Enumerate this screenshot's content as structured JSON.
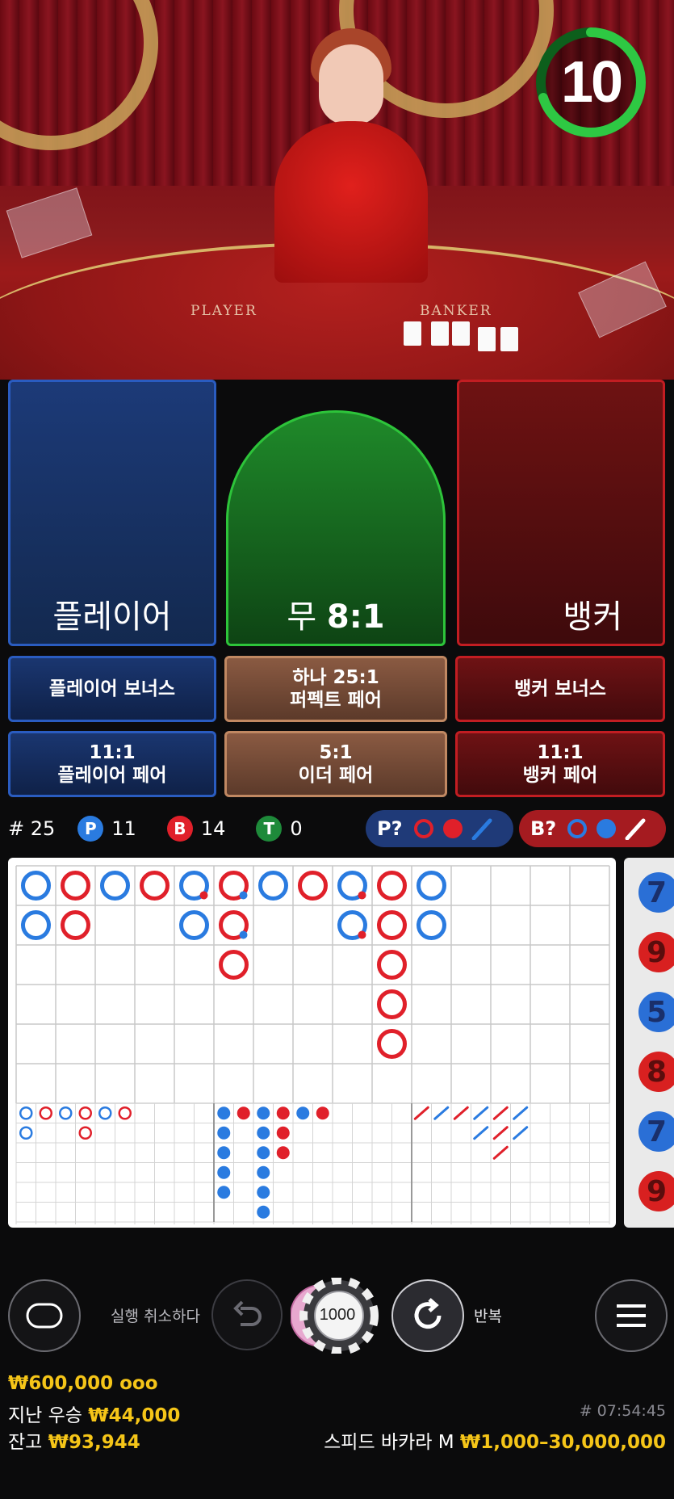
{
  "timer": {
    "value": "10",
    "color": "#2ec843",
    "fraction": 0.7
  },
  "felt": {
    "player": "PLAYER",
    "banker": "BANKER"
  },
  "bets": {
    "player": "플레이어",
    "tie_label": "무",
    "tie_odds": "8:1",
    "banker": "뱅커",
    "player_bonus": "플레이어 보너스",
    "perfect_pair_line1": "하나 25:1",
    "perfect_pair_line2": "퍼펙트 페어",
    "banker_bonus": "뱅커 보너스",
    "player_pair_odds": "11:1",
    "player_pair": "플레이어 페어",
    "either_pair_odds": "5:1",
    "either_pair": "이더 페어",
    "banker_pair_odds": "11:1",
    "banker_pair": "뱅커 페어"
  },
  "stats": {
    "round_label": "# 25",
    "player_letter": "P",
    "player_count": "11",
    "banker_letter": "B",
    "banker_count": "14",
    "tie_letter": "T",
    "tie_count": "0"
  },
  "predict": {
    "player": "P?",
    "banker": "B?"
  },
  "colors": {
    "player": "#2a7be0",
    "banker": "#e0202a",
    "tie": "#1e8a3a",
    "gold": "#f5c518"
  },
  "bead_road": {
    "columns": [
      [
        "P",
        "P"
      ],
      [
        "B",
        "B"
      ],
      [
        "P"
      ],
      [
        "B"
      ],
      [
        "Pb",
        "P"
      ],
      [
        "Bb",
        "Bb",
        "B"
      ],
      [
        "P"
      ],
      [
        "B"
      ],
      [
        "Pb",
        "Pb"
      ],
      [
        "B",
        "B",
        "B",
        "B",
        "B"
      ],
      [
        "P",
        "P"
      ]
    ]
  },
  "big_eye_road": [
    [
      "P",
      "P"
    ],
    [
      "B"
    ],
    [
      "P"
    ],
    [
      "B",
      "B"
    ],
    [
      "P"
    ],
    [
      "B"
    ]
  ],
  "small_road": [
    [
      "P",
      "P",
      "P",
      "P",
      "P"
    ],
    [
      "B"
    ],
    [
      "P",
      "P",
      "P",
      "P",
      "P",
      "P"
    ],
    [
      "B",
      "B",
      "B"
    ],
    [
      "P"
    ],
    [
      "B"
    ]
  ],
  "cockroach_road": [
    [
      "B"
    ],
    [
      "P"
    ],
    [
      "B"
    ],
    [
      "P",
      "P"
    ],
    [
      "B",
      "B",
      "B"
    ],
    [
      "P",
      "P"
    ]
  ],
  "side_numbers": [
    "7",
    "9",
    "5",
    "8",
    "7",
    "9"
  ],
  "controls": {
    "undo_label": "실행 취소하다",
    "repeat_label": "반복",
    "chip_value": "1000",
    "chat_icon": "chat-bubble-icon",
    "menu_icon": "hamburger-icon"
  },
  "footer": {
    "total_bet": "₩600,000 ooo",
    "last_win_label": "지난 우승",
    "last_win_value": "₩44,000",
    "balance_label": "잔고",
    "balance_value": "₩93,944",
    "round_id": "# 07:54:45",
    "table_name": "스피드 바카라 M",
    "table_limits": "₩1,000–30,000,000"
  }
}
